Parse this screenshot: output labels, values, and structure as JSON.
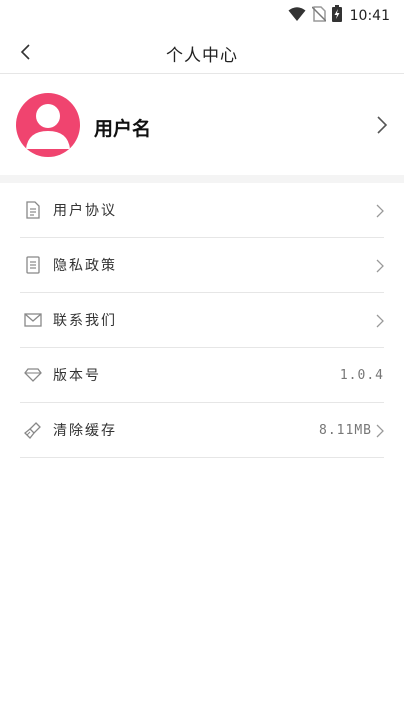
{
  "status_bar": {
    "time": "10:41"
  },
  "header": {
    "title": "个人中心"
  },
  "profile": {
    "username": "用户名",
    "avatar_color": "#f0446f"
  },
  "menu": {
    "items": [
      {
        "label": "用户协议",
        "icon": "document-icon",
        "value": ""
      },
      {
        "label": "隐私政策",
        "icon": "notebook-icon",
        "value": ""
      },
      {
        "label": "联系我们",
        "icon": "mail-icon",
        "value": ""
      },
      {
        "label": "版本号",
        "icon": "diamond-icon",
        "value": "1.0.4"
      },
      {
        "label": "清除缓存",
        "icon": "broom-icon",
        "value": "8.11MB"
      }
    ]
  }
}
